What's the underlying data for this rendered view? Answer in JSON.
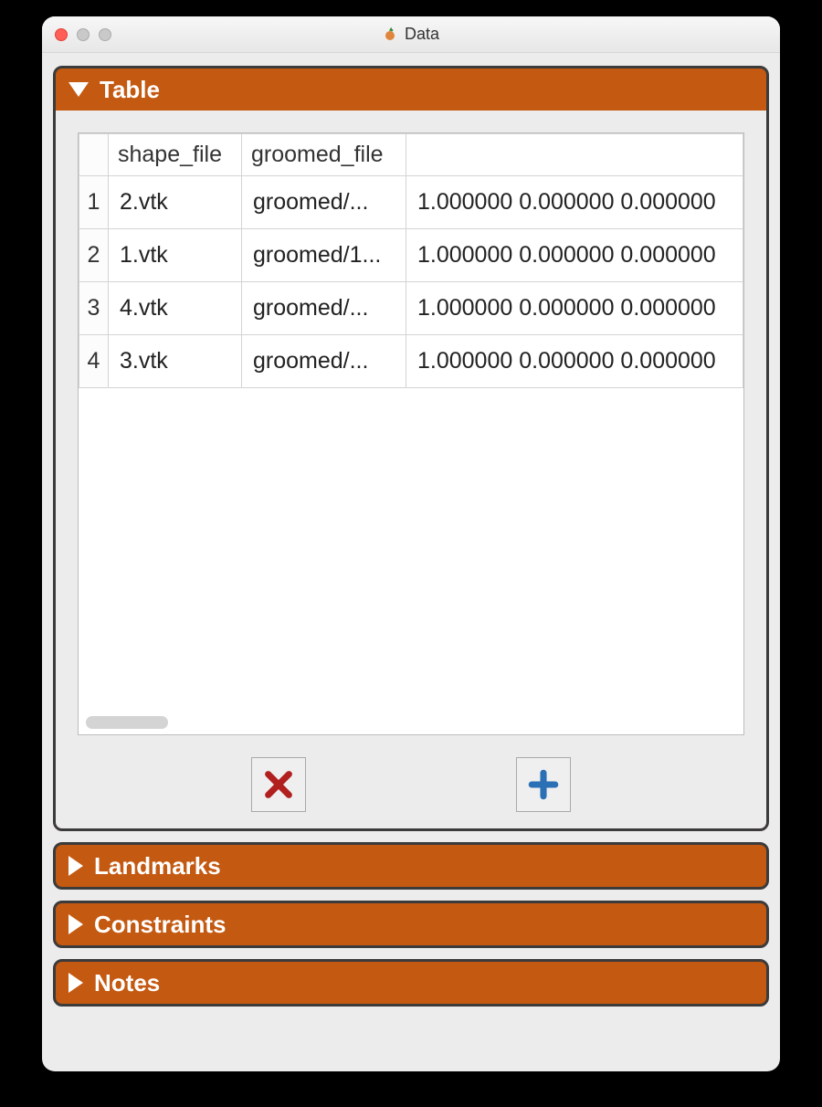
{
  "window": {
    "title": "Data"
  },
  "sections": {
    "table": {
      "label": "Table",
      "expanded": true
    },
    "landmarks": {
      "label": "Landmarks",
      "expanded": false
    },
    "constraints": {
      "label": "Constraints",
      "expanded": false
    },
    "notes": {
      "label": "Notes",
      "expanded": false
    }
  },
  "table": {
    "columns": [
      "shape_file",
      "groomed_file",
      ""
    ],
    "rows": [
      {
        "idx": "1",
        "shape_file": "2.vtk",
        "groomed_file": "groomed/...",
        "extra": "1.000000 0.000000 0.000000"
      },
      {
        "idx": "2",
        "shape_file": "1.vtk",
        "groomed_file": "groomed/1...",
        "extra": "1.000000 0.000000 0.000000"
      },
      {
        "idx": "3",
        "shape_file": "4.vtk",
        "groomed_file": "groomed/...",
        "extra": "1.000000 0.000000 0.000000"
      },
      {
        "idx": "4",
        "shape_file": "3.vtk",
        "groomed_file": "groomed/...",
        "extra": "1.000000 0.000000 0.000000"
      }
    ]
  },
  "buttons": {
    "remove": "remove",
    "add": "add"
  }
}
